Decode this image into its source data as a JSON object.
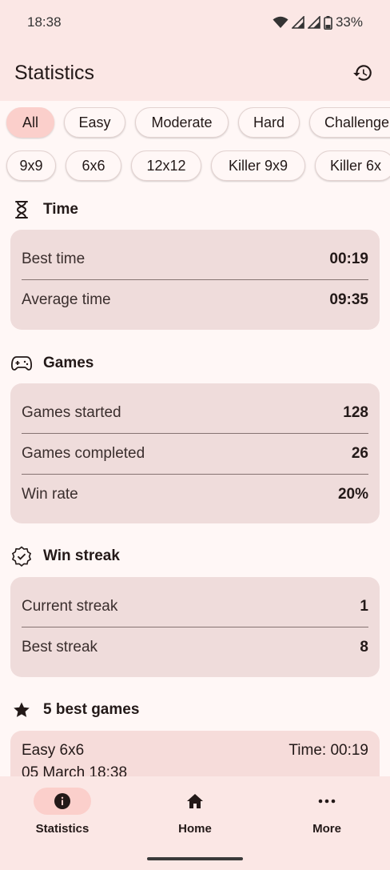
{
  "status_bar": {
    "time": "18:38",
    "battery": "33%"
  },
  "app_bar": {
    "title": "Statistics"
  },
  "difficulty_filters": [
    {
      "label": "All",
      "selected": true
    },
    {
      "label": "Easy",
      "selected": false
    },
    {
      "label": "Moderate",
      "selected": false
    },
    {
      "label": "Hard",
      "selected": false
    },
    {
      "label": "Challenge",
      "selected": false
    }
  ],
  "type_filters": [
    {
      "label": "9x9"
    },
    {
      "label": "6x6"
    },
    {
      "label": "12x12"
    },
    {
      "label": "Killer 9x9"
    },
    {
      "label": "Killer 6x"
    }
  ],
  "sections": {
    "time": {
      "title": "Time",
      "rows": [
        {
          "label": "Best time",
          "value": "00:19"
        },
        {
          "label": "Average time",
          "value": "09:35"
        }
      ]
    },
    "games": {
      "title": "Games",
      "rows": [
        {
          "label": "Games started",
          "value": "128"
        },
        {
          "label": "Games completed",
          "value": "26"
        },
        {
          "label": "Win rate",
          "value": "20%"
        }
      ]
    },
    "win_streak": {
      "title": "Win streak",
      "rows": [
        {
          "label": "Current streak",
          "value": "1"
        },
        {
          "label": "Best streak",
          "value": "8"
        }
      ]
    },
    "best_games": {
      "title": "5 best games",
      "items": [
        {
          "name": "Easy 6x6",
          "time": "Time: 00:19",
          "date": "05 March 18:38"
        }
      ]
    }
  },
  "bottom_nav": [
    {
      "label": "Statistics",
      "icon": "info-icon",
      "active": true
    },
    {
      "label": "Home",
      "icon": "home-icon",
      "active": false
    },
    {
      "label": "More",
      "icon": "more-icon",
      "active": false
    }
  ],
  "colors": {
    "background": "#fff7f6",
    "top_bar": "#fbe7e5",
    "selected_chip": "#fbcfcb",
    "card": "#efdcdb",
    "best_card": "#f6dcda"
  }
}
